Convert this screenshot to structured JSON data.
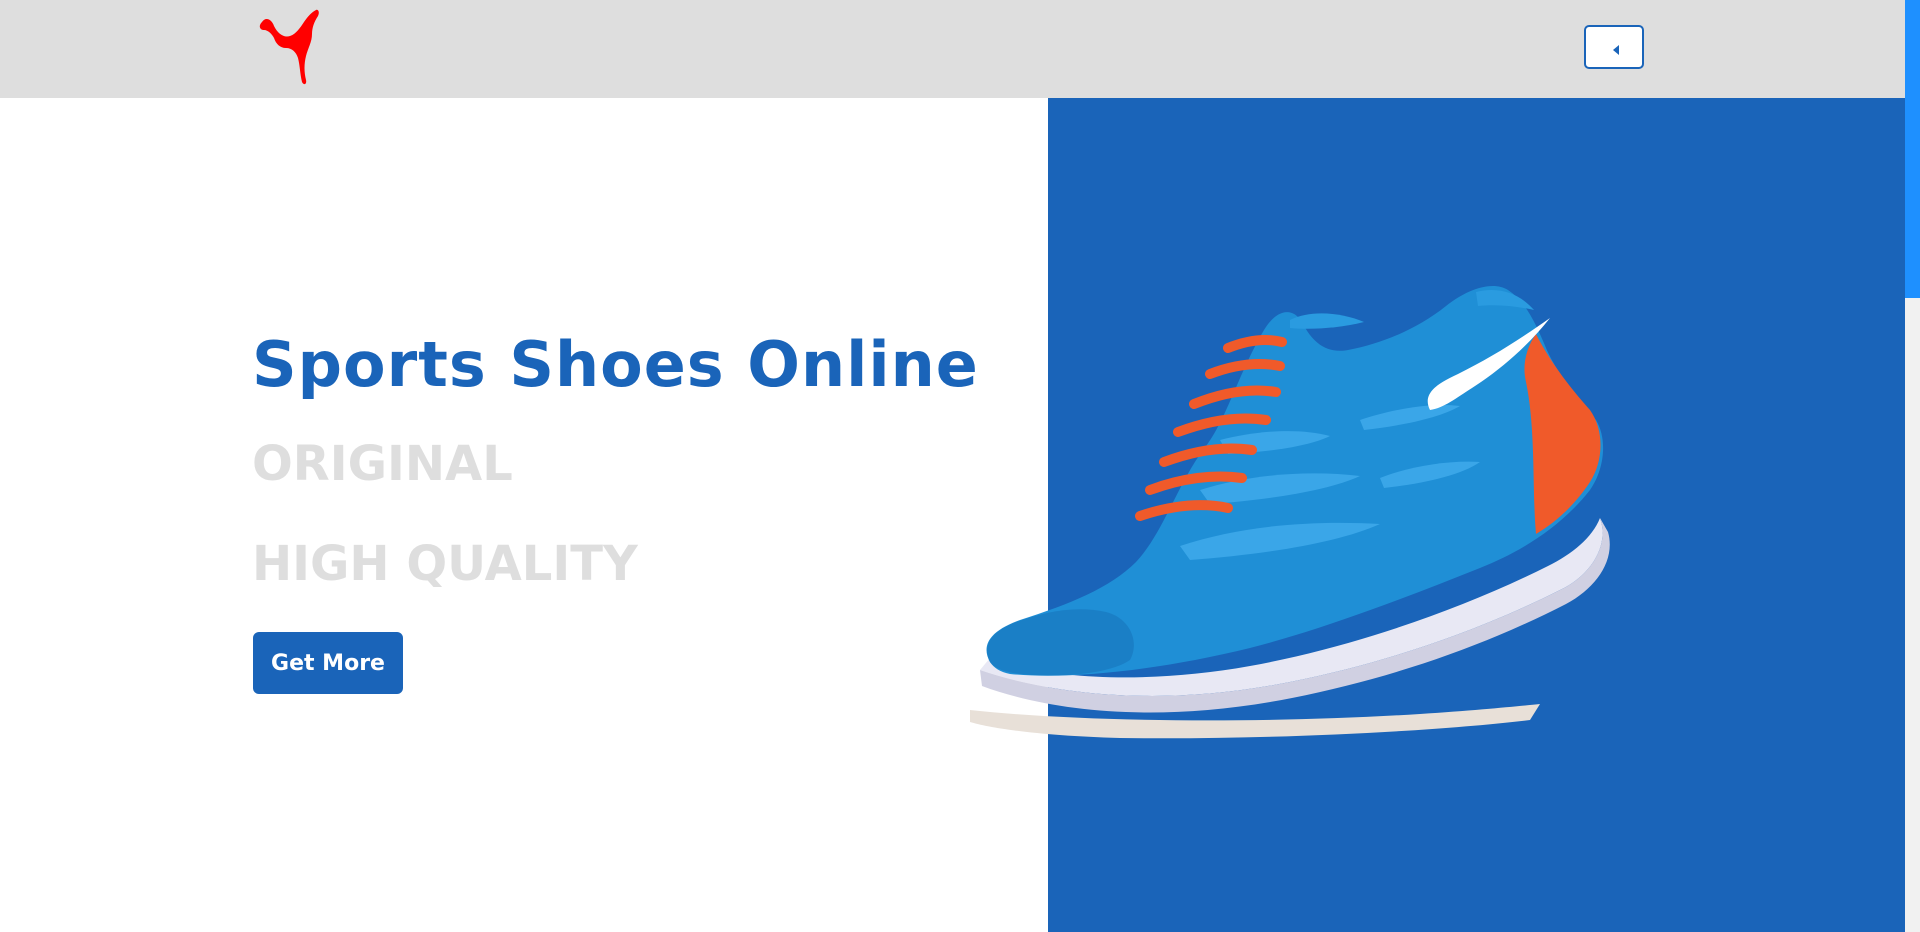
{
  "brand": {
    "logo": "puma-cat-logo",
    "logo_color": "#ff0000"
  },
  "header": {
    "background": "#dedede",
    "menu_toggle_icon": "caret-left-icon"
  },
  "hero": {
    "title": "Sports Shoes Online",
    "lines": [
      "ORIGINAL",
      "HIGH QUALITY"
    ],
    "cta_label": "Get More",
    "image": "running-shoe-image"
  },
  "colors": {
    "accent": "#1a64b9",
    "muted_text": "#dedede",
    "shoe_upper": "#1f8fd6",
    "shoe_laces": "#f05a2a",
    "sole": "#e8e8f4",
    "scrollbar_thumb": "#1e90ff"
  }
}
